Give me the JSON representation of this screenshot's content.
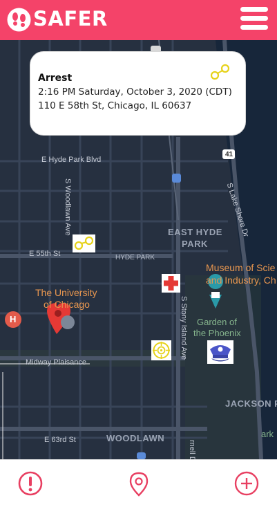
{
  "app": {
    "title": "SAFER",
    "accent_color": "#f44369"
  },
  "header": {
    "logo_icon": "footprints-icon",
    "menu_icon": "hamburger-menu-icon"
  },
  "popup": {
    "title": "Arrest",
    "datetime": "2:16 PM Saturday, October 3, 2020 (CDT)",
    "address": "110 E 58th St, Chicago, IL 60637",
    "icon": "handcuffs-icon"
  },
  "map": {
    "labels": {
      "hyde_park_blvd": "E Hyde Park Blvd",
      "woodlawn_ave": "S Woodlawn Ave",
      "e_55th": "E 55th St",
      "hyde_park_small": "HYDE PARK",
      "east_hyde_park_1": "EAST HYDE",
      "east_hyde_park_2": "PARK",
      "museum_1": "Museum of Scie",
      "museum_2": "and Industry, Ch",
      "uchicago_1": "The University",
      "uchicago_2": "of Chicago",
      "garden_1": "Garden of",
      "garden_2": "the Phoenix",
      "stony_island": "S Stony Island Ave",
      "lake_shore": "S Lake Shore Dr",
      "midway": "Midway Plaisance",
      "jackson_park": "JACKSON PA",
      "e_63rd": "E 63rd St",
      "woodlawn": "WOODLAWN",
      "route_41": "41",
      "park_fragment": "ark",
      "cornell_fragment": "rnell Dr"
    },
    "markers": [
      {
        "type": "arrest",
        "icon": "handcuffs-icon",
        "color": "#e6d21a"
      },
      {
        "type": "medical",
        "icon": "red-cross-icon",
        "color": "#e53935"
      },
      {
        "type": "shooting",
        "icon": "crosshair-target-icon",
        "color": "#e6d21a"
      },
      {
        "type": "police",
        "icon": "police-cap-icon",
        "color": "#4a55c8"
      }
    ]
  },
  "bottom_nav": {
    "report_icon": "exclamation-circle-icon",
    "location_icon": "location-pin-icon",
    "add_icon": "plus-circle-icon"
  }
}
